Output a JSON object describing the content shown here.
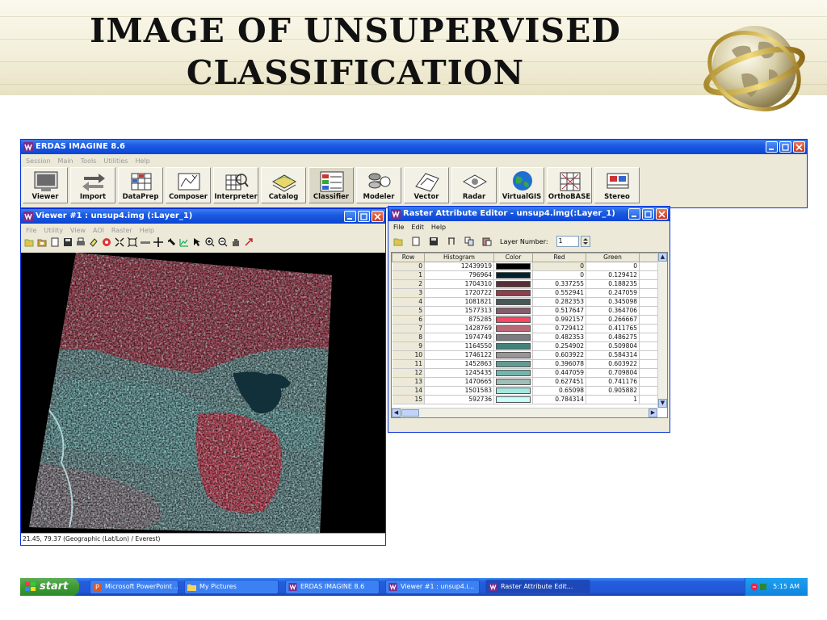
{
  "slide": {
    "title": "Image of Unsupervised Classification"
  },
  "erdas": {
    "title": "ERDAS IMAGINE 8.6",
    "menu": [
      "Session",
      "Main",
      "Tools",
      "Utilities",
      "Help"
    ],
    "tools": [
      {
        "label": "Viewer",
        "icon": "viewer-icon"
      },
      {
        "label": "Import",
        "icon": "import-icon"
      },
      {
        "label": "DataPrep",
        "icon": "dataprep-icon"
      },
      {
        "label": "Composer",
        "icon": "composer-icon"
      },
      {
        "label": "Interpreter",
        "icon": "interpreter-icon"
      },
      {
        "label": "Catalog",
        "icon": "catalog-icon"
      },
      {
        "label": "Classifier",
        "icon": "classifier-icon"
      },
      {
        "label": "Modeler",
        "icon": "modeler-icon"
      },
      {
        "label": "Vector",
        "icon": "vector-icon"
      },
      {
        "label": "Radar",
        "icon": "radar-icon"
      },
      {
        "label": "VirtualGIS",
        "icon": "globe-icon"
      },
      {
        "label": "OrthoBASE",
        "icon": "orthobase-icon"
      },
      {
        "label": "Stereo",
        "icon": "stereo-icon"
      }
    ]
  },
  "viewer": {
    "title": "Viewer #1 : unsup4.img (:Layer_1)",
    "menu": [
      "File",
      "Utility",
      "View",
      "AOI",
      "Raster",
      "Help"
    ],
    "status": "21.45, 79.37  (Geographic (Lat/Lon) / Everest)"
  },
  "rae": {
    "title": "Raster Attribute Editor - unsup4.img(:Layer_1)",
    "menu": [
      "File",
      "Edit",
      "Help"
    ],
    "layer_label": "Layer Number:",
    "layer_value": "1",
    "columns": [
      "Row",
      "Histogram",
      "Color",
      "Red",
      "Green"
    ],
    "rows": [
      {
        "row": "0",
        "histogram": "12439919",
        "color": "#000000",
        "red": "0",
        "green": "0"
      },
      {
        "row": "1",
        "histogram": "796964",
        "color": "#00212e",
        "red": "0",
        "green": "0.129412"
      },
      {
        "row": "2",
        "histogram": "1704310",
        "color": "#563036",
        "red": "0.337255",
        "green": "0.188235"
      },
      {
        "row": "3",
        "histogram": "1720722",
        "color": "#8d3f4d",
        "red": "0.552941",
        "green": "0.247059"
      },
      {
        "row": "4",
        "histogram": "1081821",
        "color": "#485855",
        "red": "0.282353",
        "green": "0.345098"
      },
      {
        "row": "5",
        "histogram": "1577313",
        "color": "#845d6c",
        "red": "0.517647",
        "green": "0.364706"
      },
      {
        "row": "6",
        "histogram": "875285",
        "color": "#fd4460",
        "red": "0.992157",
        "green": "0.266667"
      },
      {
        "row": "7",
        "histogram": "1428769",
        "color": "#ba6979",
        "red": "0.729412",
        "green": "0.411765"
      },
      {
        "row": "8",
        "histogram": "1974749",
        "color": "#7b7c82",
        "red": "0.482353",
        "green": "0.486275"
      },
      {
        "row": "9",
        "histogram": "1164550",
        "color": "#41827a",
        "red": "0.254902",
        "green": "0.509804"
      },
      {
        "row": "10",
        "histogram": "1746122",
        "color": "#9a9596",
        "red": "0.603922",
        "green": "0.584314"
      },
      {
        "row": "11",
        "histogram": "1452863",
        "color": "#659a94",
        "red": "0.396078",
        "green": "0.603922"
      },
      {
        "row": "12",
        "histogram": "1245435",
        "color": "#72b5ac",
        "red": "0.447059",
        "green": "0.709804"
      },
      {
        "row": "13",
        "histogram": "1470665",
        "color": "#a0bdb8",
        "red": "0.627451",
        "green": "0.741176"
      },
      {
        "row": "14",
        "histogram": "1501583",
        "color": "#a6e7e0",
        "red": "0.65098",
        "green": "0.905882"
      },
      {
        "row": "15",
        "histogram": "592736",
        "color": "#c8fffa",
        "red": "0.784314",
        "green": "1"
      }
    ]
  },
  "taskbar": {
    "start": "start",
    "tasks": [
      {
        "label": "Microsoft PowerPoint ...",
        "icon": "powerpoint-icon"
      },
      {
        "label": "My Pictures",
        "icon": "folder-icon"
      },
      {
        "label": "ERDAS IMAGINE 8.6",
        "icon": "erdas-icon"
      },
      {
        "label": "Viewer #1 : unsup4.i...",
        "icon": "erdas-icon"
      },
      {
        "label": "Raster Attribute Edit...",
        "icon": "erdas-icon"
      }
    ],
    "time": "5:15 AM"
  }
}
